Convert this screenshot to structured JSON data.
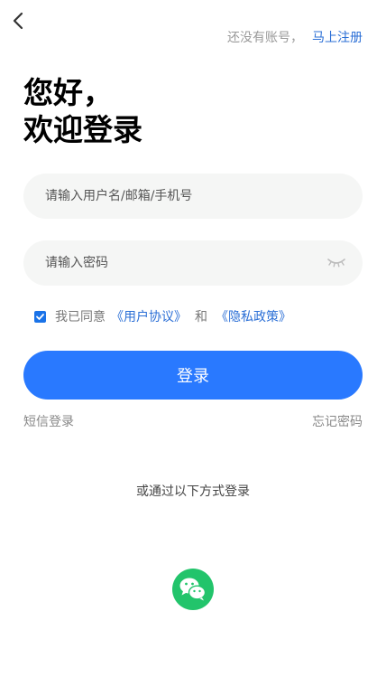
{
  "header": {
    "back_icon": "chevron-left-icon",
    "no_account_hint": "还没有账号，",
    "register_link": "马上注册"
  },
  "greeting": {
    "line1": "您好，",
    "line2": "欢迎登录"
  },
  "form": {
    "username_placeholder": "请输入用户名/邮箱/手机号",
    "username_value": "",
    "password_placeholder": "请输入密码",
    "password_value": "",
    "password_toggle_icon": "eye-closed-icon"
  },
  "agreement": {
    "checked": true,
    "prefix": "我已同意",
    "user_agreement": "《用户协议》",
    "conjunction": "和",
    "privacy_policy": "《隐私政策》"
  },
  "actions": {
    "login_label": "登录",
    "sms_login": "短信登录",
    "forgot_password": "忘记密码"
  },
  "alternative": {
    "title": "或通过以下方式登录",
    "wechat_icon": "wechat-icon"
  },
  "colors": {
    "primary": "#2979ff",
    "link": "#2b6fd6",
    "wechat": "#22c46b",
    "field_bg": "#f5f6f5"
  }
}
